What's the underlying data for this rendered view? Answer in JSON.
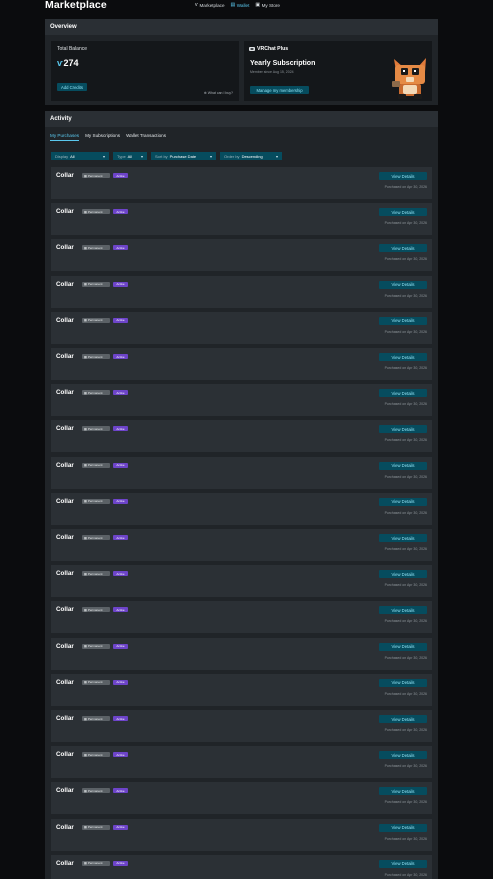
{
  "header": {
    "title": "Marketplace",
    "nav": [
      {
        "label": "Marketplace",
        "icon": "marketplace-icon",
        "glyph": "ⱱ",
        "active": false
      },
      {
        "label": "Wallet",
        "icon": "wallet-icon",
        "glyph": "▤",
        "active": true
      },
      {
        "label": "My Store",
        "icon": "store-icon",
        "glyph": "▣",
        "active": false
      }
    ]
  },
  "overview": {
    "heading": "Overview",
    "balance": {
      "label": "Total Balance",
      "currency_symbol": "ⱱ",
      "value": "274",
      "add_credits": "Add Credits",
      "what_label": "What can I buy?"
    },
    "vrchat_plus": {
      "label": "VRChat Plus",
      "plan": "Yearly Subscription",
      "since": "Member since Aug 15, 2024",
      "manage": "Manage my membership"
    }
  },
  "activity": {
    "heading": "Activity",
    "tabs": [
      {
        "label": "My Purchases",
        "active": true
      },
      {
        "label": "My Subscriptions",
        "active": false
      },
      {
        "label": "Wallet Transactions",
        "active": false
      }
    ],
    "filters": [
      {
        "label": "Display",
        "value": "All"
      },
      {
        "label": "Type",
        "value": "All"
      },
      {
        "label": "Sort by",
        "value": "Purchase Date"
      },
      {
        "label": "Order by",
        "value": "Descending"
      }
    ],
    "purchases": [
      {
        "name": "Collar",
        "type_badge": "Permanent",
        "status": "Active",
        "button": "View Details",
        "date": "Purchased on Apr 30, 2026"
      },
      {
        "name": "Collar",
        "type_badge": "Permanent",
        "status": "Active",
        "button": "View Details",
        "date": "Purchased on Apr 30, 2026"
      },
      {
        "name": "Collar",
        "type_badge": "Permanent",
        "status": "Active",
        "button": "View Details",
        "date": "Purchased on Apr 30, 2026"
      },
      {
        "name": "Collar",
        "type_badge": "Permanent",
        "status": "Active",
        "button": "View Details",
        "date": "Purchased on Apr 30, 2026"
      },
      {
        "name": "Collar",
        "type_badge": "Permanent",
        "status": "Active",
        "button": "View Details",
        "date": "Purchased on Apr 30, 2026"
      },
      {
        "name": "Collar",
        "type_badge": "Permanent",
        "status": "Active",
        "button": "View Details",
        "date": "Purchased on Apr 30, 2026"
      },
      {
        "name": "Collar",
        "type_badge": "Permanent",
        "status": "Active",
        "button": "View Details",
        "date": "Purchased on Apr 30, 2026"
      },
      {
        "name": "Collar",
        "type_badge": "Permanent",
        "status": "Active",
        "button": "View Details",
        "date": "Purchased on Apr 30, 2026"
      },
      {
        "name": "Collar",
        "type_badge": "Permanent",
        "status": "Active",
        "button": "View Details",
        "date": "Purchased on Apr 30, 2026"
      },
      {
        "name": "Collar",
        "type_badge": "Permanent",
        "status": "Active",
        "button": "View Details",
        "date": "Purchased on Apr 30, 2026"
      },
      {
        "name": "Collar",
        "type_badge": "Permanent",
        "status": "Active",
        "button": "View Details",
        "date": "Purchased on Apr 30, 2026"
      },
      {
        "name": "Collar",
        "type_badge": "Permanent",
        "status": "Active",
        "button": "View Details",
        "date": "Purchased on Apr 30, 2026"
      },
      {
        "name": "Collar",
        "type_badge": "Permanent",
        "status": "Active",
        "button": "View Details",
        "date": "Purchased on Apr 30, 2026"
      },
      {
        "name": "Collar",
        "type_badge": "Permanent",
        "status": "Active",
        "button": "View Details",
        "date": "Purchased on Apr 30, 2026"
      },
      {
        "name": "Collar",
        "type_badge": "Permanent",
        "status": "Active",
        "button": "View Details",
        "date": "Purchased on Apr 30, 2026"
      },
      {
        "name": "Collar",
        "type_badge": "Permanent",
        "status": "Active",
        "button": "View Details",
        "date": "Purchased on Apr 30, 2026"
      },
      {
        "name": "Collar",
        "type_badge": "Permanent",
        "status": "Active",
        "button": "View Details",
        "date": "Purchased on Apr 30, 2026"
      },
      {
        "name": "Collar",
        "type_badge": "Permanent",
        "status": "Active",
        "button": "View Details",
        "date": "Purchased on Apr 30, 2026"
      },
      {
        "name": "Collar",
        "type_badge": "Permanent",
        "status": "Active",
        "button": "View Details",
        "date": "Purchased on Apr 30, 2026"
      },
      {
        "name": "Collar",
        "type_badge": "Permanent",
        "status": "Active",
        "button": "View Details",
        "date": "Purchased on Apr 30, 2026"
      }
    ]
  },
  "colors": {
    "accent": "#5ac8ee",
    "button_bg": "#064c5e",
    "active_badge": "#6d44c9",
    "panel": "#202428",
    "row": "#2b3035"
  }
}
